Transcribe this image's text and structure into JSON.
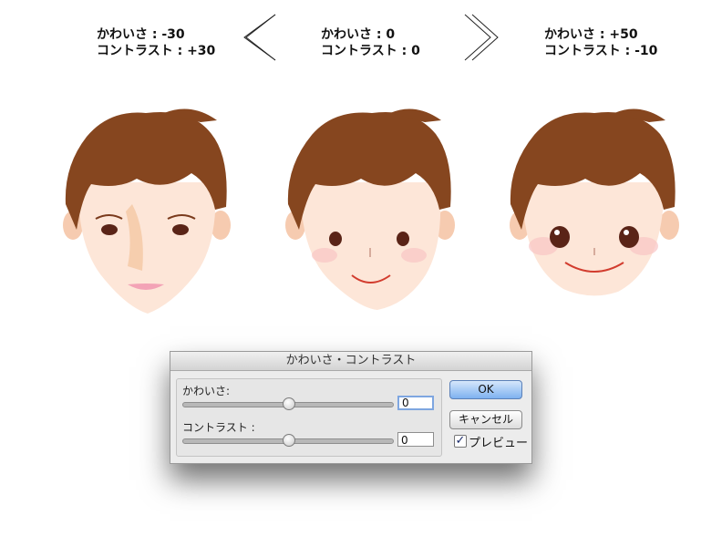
{
  "labels": {
    "left": {
      "line1": "かわいさ : -30",
      "line2": "コントラスト : +30"
    },
    "middle": {
      "line1": "かわいさ : 0",
      "line2": "コントラスト : 0"
    },
    "right": {
      "line1": "かわいさ : +50",
      "line2": "コントラスト : -10"
    }
  },
  "dialog": {
    "title": "かわいさ・コントラスト",
    "kawaisa": {
      "label": "かわいさ:",
      "value": "0",
      "slider_fraction": 0.5
    },
    "contrast": {
      "label": "コントラスト :",
      "value": "0",
      "slider_fraction": 0.5
    },
    "ok_label": "OK",
    "cancel_label": "キャンセル",
    "preview_label": "プレビュー",
    "preview_checked": true,
    "check_mark": "✓"
  },
  "colors": {
    "hair": "#86461f",
    "skin": "#fde2d4",
    "eye": "#5a2417",
    "mouth": "#d23c2e",
    "ok_button": "#7eb1f0"
  },
  "icons": [
    "chevron-left-icon",
    "chevron-right-icon",
    "checkbox-icon"
  ]
}
